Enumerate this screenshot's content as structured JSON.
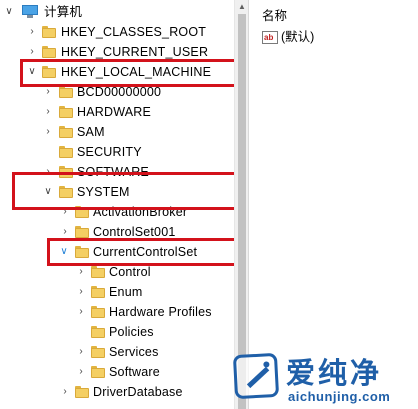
{
  "tree": {
    "root": {
      "label": "计算机"
    },
    "hkey_classes_root": {
      "label": "HKEY_CLASSES_ROOT"
    },
    "hkey_current_user": {
      "label": "HKEY_CURRENT_USER"
    },
    "hkey_local_machine": {
      "label": "HKEY_LOCAL_MACHINE"
    },
    "bcd": {
      "label": "BCD00000000"
    },
    "hardware": {
      "label": "HARDWARE"
    },
    "sam": {
      "label": "SAM"
    },
    "security": {
      "label": "SECURITY"
    },
    "software": {
      "label": "SOFTWARE"
    },
    "system": {
      "label": "SYSTEM"
    },
    "activation_broker": {
      "label": "ActivationBroker"
    },
    "controlset001": {
      "label": "ControlSet001"
    },
    "current_control_set": {
      "label": "CurrentControlSet"
    },
    "control": {
      "label": "Control"
    },
    "enum": {
      "label": "Enum"
    },
    "hardware_profiles": {
      "label": "Hardware Profiles"
    },
    "policies": {
      "label": "Policies"
    },
    "services": {
      "label": "Services"
    },
    "software_sub": {
      "label": "Software"
    },
    "driver_database": {
      "label": "DriverDatabase"
    }
  },
  "values": {
    "column_name": "名称",
    "default_value_name": "(默认)",
    "string_icon": "ab"
  },
  "watermark": {
    "chinese": "爱纯净",
    "url": "aichunjing.com"
  },
  "colors": {
    "highlight_border": "#d3121b",
    "folder": "#f4cf63",
    "watermark": "#1f5fa8"
  }
}
